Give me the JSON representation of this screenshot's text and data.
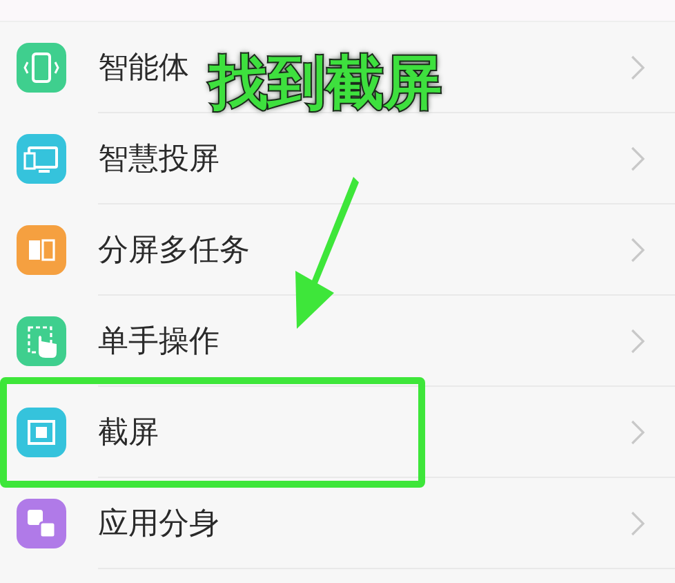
{
  "settings_list": {
    "items": [
      {
        "label": "智能体",
        "kind": "motion",
        "color": "#3fcf8e",
        "highlighted": false
      },
      {
        "label": "智慧投屏",
        "kind": "cast",
        "color": "#35c3dc",
        "highlighted": false
      },
      {
        "label": "分屏多任务",
        "kind": "split",
        "color": "#f5a040",
        "highlighted": false
      },
      {
        "label": "单手操作",
        "kind": "onehand",
        "color": "#3fcf8e",
        "highlighted": false
      },
      {
        "label": "截屏",
        "kind": "screenshot",
        "color": "#35c3dc",
        "highlighted": true
      },
      {
        "label": "应用分身",
        "kind": "clone",
        "color": "#b07ae8",
        "highlighted": false
      }
    ]
  },
  "annotation": {
    "callout": "找到截屏"
  }
}
